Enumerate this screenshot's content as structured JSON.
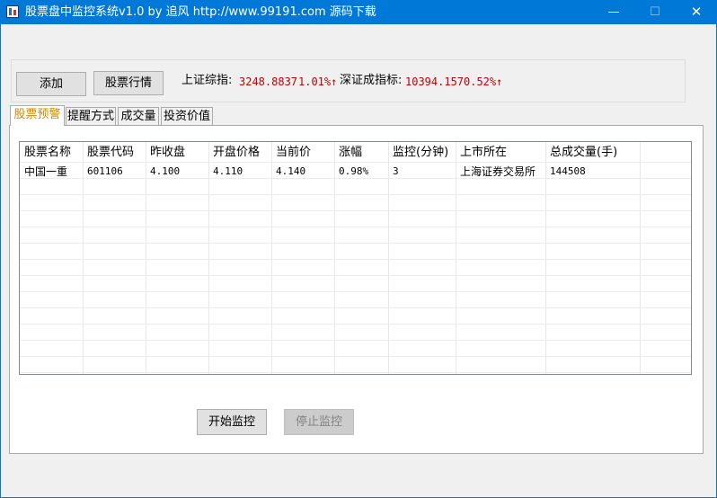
{
  "window": {
    "title": "股票盘中监控系统v1.0 by 追风 http://www.99191.com 源码下载",
    "minimize_glyph": "—",
    "maximize_glyph": "☐",
    "close_glyph": "✕",
    "app_icon": "stock-chart-icon"
  },
  "toolbar": {
    "add_label": "添加",
    "quote_label": "股票行情",
    "sh_label": "上证综指:",
    "sh_value": "3248.8837",
    "sh_change": "1.01%↑",
    "sz_label": "深证成指标:",
    "sz_value": "10394.157",
    "sz_change": "0.52%↑",
    "index_color": "#c00000"
  },
  "tabs": [
    {
      "label": "股票预警",
      "active": true
    },
    {
      "label": "提醒方式",
      "active": false
    },
    {
      "label": "成交量",
      "active": false
    },
    {
      "label": "投资价值",
      "active": false
    }
  ],
  "grid": {
    "columns": [
      "股票名称",
      "股票代码",
      "昨收盘",
      "开盘价格",
      "当前价",
      "涨幅",
      "监控(分钟)",
      "上市所在",
      "总成交量(手)"
    ],
    "rows": [
      [
        "中国一重",
        "601106",
        "4.100",
        "4.110",
        "4.140",
        "0.98%",
        "3",
        "上海证券交易所",
        "144508"
      ]
    ]
  },
  "actions": {
    "start_label": "开始监控",
    "stop_label": "停止监控",
    "stop_enabled": false
  }
}
